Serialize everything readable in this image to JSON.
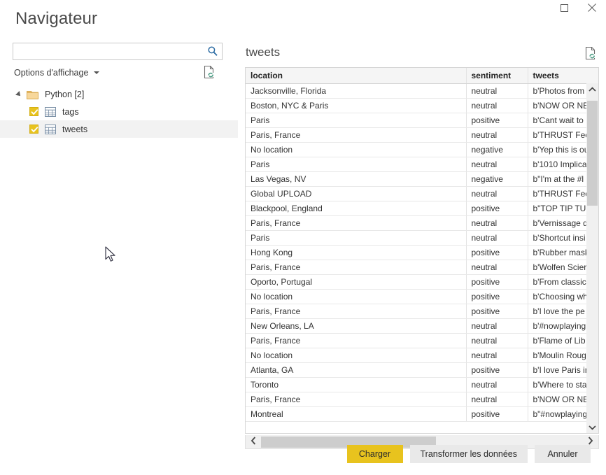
{
  "window": {
    "title": "Navigateur",
    "controls": [
      {
        "name": "maximize",
        "glyph": "maximize-icon"
      },
      {
        "name": "close",
        "glyph": "close-icon"
      }
    ]
  },
  "search": {
    "value": "",
    "placeholder": "",
    "icon": "search-icon"
  },
  "display_options": {
    "label": "Options d'affichage",
    "caret": "chevron-down-icon",
    "refresh_icon": "refresh-document-icon"
  },
  "tree": {
    "root": {
      "label": "Python [2]",
      "expanded": true,
      "icon": "folder-icon"
    },
    "items": [
      {
        "label": "tags",
        "checked": true,
        "selected": false,
        "icon": "table-icon"
      },
      {
        "label": "tweets",
        "checked": true,
        "selected": true,
        "icon": "table-icon"
      }
    ]
  },
  "preview": {
    "title": "tweets",
    "refresh_icon": "refresh-document-icon",
    "columns": [
      "location",
      "sentiment",
      "tweets"
    ],
    "rows": [
      [
        "Jacksonville, Florida",
        "neutral",
        "b'Photos from"
      ],
      [
        "Boston, NYC & Paris",
        "neutral",
        "b'NOW OR NE"
      ],
      [
        "Paris",
        "positive",
        "b'Cant wait to"
      ],
      [
        "Paris, France",
        "neutral",
        "b'THRUST Fee"
      ],
      [
        "No location",
        "negative",
        "b'Yep this is ou"
      ],
      [
        "Paris",
        "neutral",
        "b'1010 Implica"
      ],
      [
        "Las Vegas, NV",
        "negative",
        "b\"I'm at the #l"
      ],
      [
        "Global UPLOAD",
        "neutral",
        "b'THRUST Fee"
      ],
      [
        "Blackpool, England",
        "positive",
        "b\"TOP TIP TUE"
      ],
      [
        "Paris, France",
        "neutral",
        "b'Vernissage d"
      ],
      [
        "Paris",
        "neutral",
        "b'Shortcut insi"
      ],
      [
        "Hong Kong",
        "positive",
        "b'Rubber mask"
      ],
      [
        "Paris, France",
        "neutral",
        "b'Wolfen Scier"
      ],
      [
        "Oporto, Portugal",
        "positive",
        "b'From classic"
      ],
      [
        "No location",
        "positive",
        "b'Choosing wh"
      ],
      [
        "Paris, France",
        "positive",
        "b'I love the pe"
      ],
      [
        "New Orleans, LA",
        "neutral",
        "b'#nowplaying"
      ],
      [
        "Paris, France",
        "neutral",
        "b'Flame of Lib"
      ],
      [
        "No location",
        "neutral",
        "b'Moulin Roug"
      ],
      [
        "Atlanta, GA",
        "positive",
        "b'I love Paris ir"
      ],
      [
        "Toronto",
        "neutral",
        "b'Where to sta"
      ],
      [
        "Paris, France",
        "neutral",
        "b'NOW OR NE"
      ],
      [
        "Montreal",
        "positive",
        "b\"#nowplaying"
      ]
    ]
  },
  "scrollbars": {
    "vertical": {
      "up_icon": "chevron-up-icon",
      "down_icon": "chevron-down-icon"
    },
    "horizontal": {
      "left_icon": "chevron-left-icon",
      "right_icon": "chevron-right-icon"
    }
  },
  "footer": {
    "load_label": "Charger",
    "transform_label": "Transformer les données",
    "cancel_label": "Annuler"
  },
  "colors": {
    "accent": "#e8c31e",
    "header_bg": "#f5f5f5",
    "selection_bg": "#f2f2f2",
    "search_icon": "#2e6da4"
  }
}
